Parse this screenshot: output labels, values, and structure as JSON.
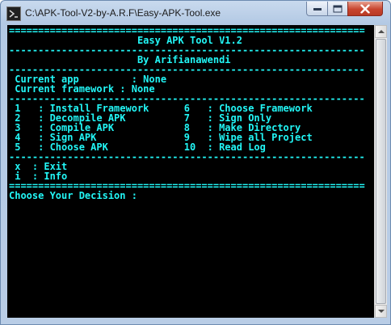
{
  "window": {
    "title": "C:\\APK-Tool-V2-by-A.R.F\\Easy-APK-Tool.exe"
  },
  "console": {
    "lines": [
      "=============================================================",
      "                      Easy APK Tool V1.2",
      "-------------------------------------------------------------",
      "                      By Arifianawendi",
      "-------------------------------------------------------------",
      " Current app         : None",
      " Current framework : None",
      "-------------------------------------------------------------",
      " 1   : Install Framework      6   : Choose Framework",
      " 2   : Decompile APK          7   : Sign Only",
      " 3   : Compile APK            8   : Make Directory",
      " 4   : Sign APK               9   : Wipe all Project",
      " 5   : Choose APK             10  : Read Log",
      "-------------------------------------------------------------",
      " x  : Exit",
      " i  : Info",
      "=============================================================",
      "Choose Your Decision :"
    ]
  },
  "colors": {
    "console_text": "#22f6f6",
    "console_background": "#000000",
    "close_button": "#c8452f"
  },
  "icons": {
    "app": "terminal-icon",
    "minimize": "minimize-icon",
    "maximize": "maximize-icon",
    "close": "close-icon",
    "scroll_up": "chevron-up-icon",
    "scroll_down": "chevron-down-icon"
  }
}
